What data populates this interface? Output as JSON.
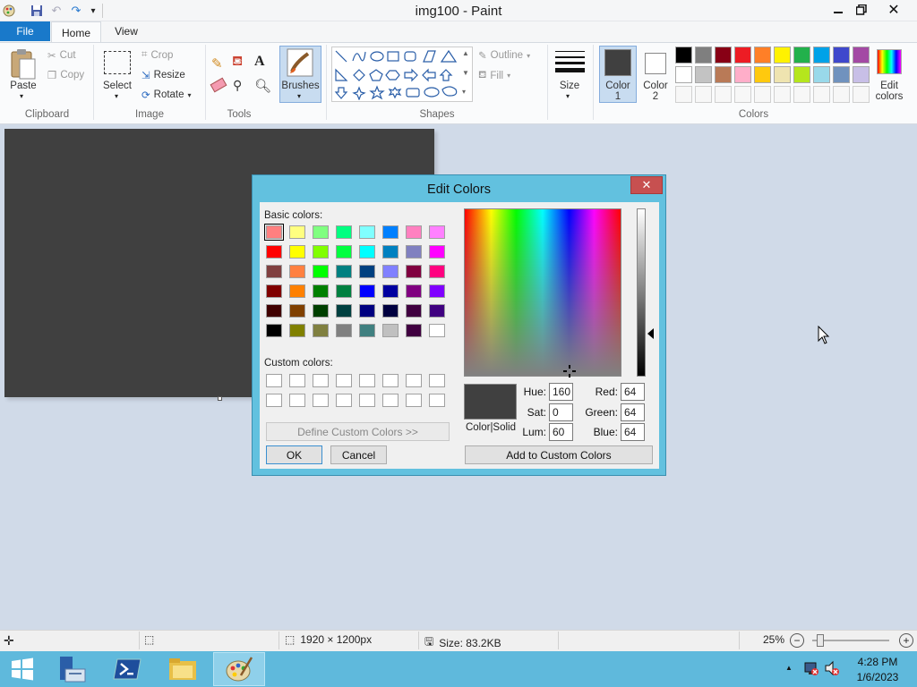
{
  "window": {
    "title": "img100 - Paint"
  },
  "tabs": {
    "file": "File",
    "home": "Home",
    "view": "View"
  },
  "clipboard": {
    "paste": "Paste",
    "cut": "Cut",
    "copy": "Copy",
    "group": "Clipboard"
  },
  "image": {
    "select": "Select",
    "crop": "Crop",
    "resize": "Resize",
    "rotate": "Rotate",
    "group": "Image"
  },
  "tools": {
    "group": "Tools"
  },
  "brushes": {
    "label": "Brushes"
  },
  "shapes": {
    "outline": "Outline",
    "fill": "Fill",
    "group": "Shapes"
  },
  "size": {
    "label": "Size"
  },
  "colors": {
    "color1_a": "Color",
    "color1_b": "1",
    "color2_a": "Color",
    "color2_b": "2",
    "edit_a": "Edit",
    "edit_b": "colors",
    "group": "Colors",
    "color1_value": "#404040",
    "color2_value": "#ffffff",
    "palette_row1": [
      "#000000",
      "#7f7f7f",
      "#880015",
      "#ed1c24",
      "#ff7f27",
      "#fff200",
      "#22b14c",
      "#00a2e8",
      "#3f48cc",
      "#a349a4"
    ],
    "palette_row2": [
      "#ffffff",
      "#c3c3c3",
      "#b97a57",
      "#ffaec9",
      "#ffc90e",
      "#efe4b0",
      "#b5e61d",
      "#99d9ea",
      "#7092be",
      "#c8bfe7"
    ]
  },
  "dialog": {
    "title": "Edit Colors",
    "basic_label": "Basic colors:",
    "custom_label": "Custom colors:",
    "define_button": "Define Custom Colors >>",
    "ok": "OK",
    "cancel": "Cancel",
    "add_button": "Add to Custom Colors",
    "color_solid": "Color|Solid",
    "hue_label": "Hue:",
    "hue": "160",
    "sat_label": "Sat:",
    "sat": "0",
    "lum_label": "Lum:",
    "lum": "60",
    "red_label": "Red:",
    "red": "64",
    "green_label": "Green:",
    "green": "64",
    "blue_label": "Blue:",
    "blue": "64",
    "preview_color": "#404040",
    "basic_colors": [
      [
        "#ff8080",
        "#ffff80",
        "#80ff80",
        "#00ff80",
        "#80ffff",
        "#0080ff",
        "#ff80c0",
        "#ff80ff"
      ],
      [
        "#ff0000",
        "#ffff00",
        "#80ff00",
        "#00ff40",
        "#00ffff",
        "#0080c0",
        "#8080c0",
        "#ff00ff"
      ],
      [
        "#804040",
        "#ff8040",
        "#00ff00",
        "#008080",
        "#004080",
        "#8080ff",
        "#800040",
        "#ff0080"
      ],
      [
        "#800000",
        "#ff8000",
        "#008000",
        "#008040",
        "#0000ff",
        "#0000a0",
        "#800080",
        "#8000ff"
      ],
      [
        "#400000",
        "#804000",
        "#004000",
        "#004040",
        "#000080",
        "#000040",
        "#400040",
        "#400080"
      ],
      [
        "#000000",
        "#808000",
        "#808040",
        "#808080",
        "#408080",
        "#c0c0c0",
        "#400040",
        "#ffffff"
      ]
    ]
  },
  "status": {
    "dimensions": "1920 × 1200px",
    "size": "Size: 83.2KB",
    "zoom": "25%"
  },
  "taskbar": {
    "time": "4:28 PM",
    "date": "1/6/2023"
  }
}
